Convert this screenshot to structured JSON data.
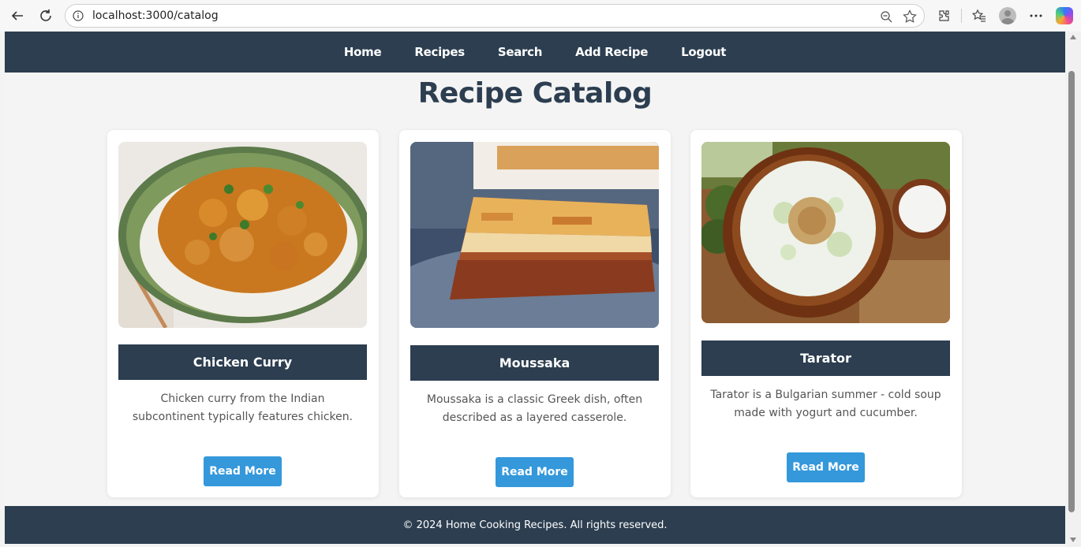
{
  "browser": {
    "url": "localhost:3000/catalog"
  },
  "nav": {
    "items": [
      {
        "label": "Home"
      },
      {
        "label": "Recipes"
      },
      {
        "label": "Search"
      },
      {
        "label": "Add Recipe"
      },
      {
        "label": "Logout"
      }
    ]
  },
  "main": {
    "title": "Recipe Catalog",
    "recipes": [
      {
        "title": "Chicken Curry",
        "description": "Chicken curry from the Indian subcontinent typically features chicken.",
        "button": "Read More"
      },
      {
        "title": "Moussaka",
        "description": "Moussaka is a classic Greek dish, often described as a layered casserole.",
        "button": "Read More"
      },
      {
        "title": "Tarator",
        "description": "Tarator is a Bulgarian summer - cold soup made with yogurt and cucumber.",
        "button": "Read More"
      }
    ]
  },
  "footer": {
    "text": "© 2024 Home Cooking Recipes. All rights reserved."
  },
  "colors": {
    "navy": "#2c3e50",
    "accent": "#3498db",
    "background": "#f4f4f4"
  }
}
